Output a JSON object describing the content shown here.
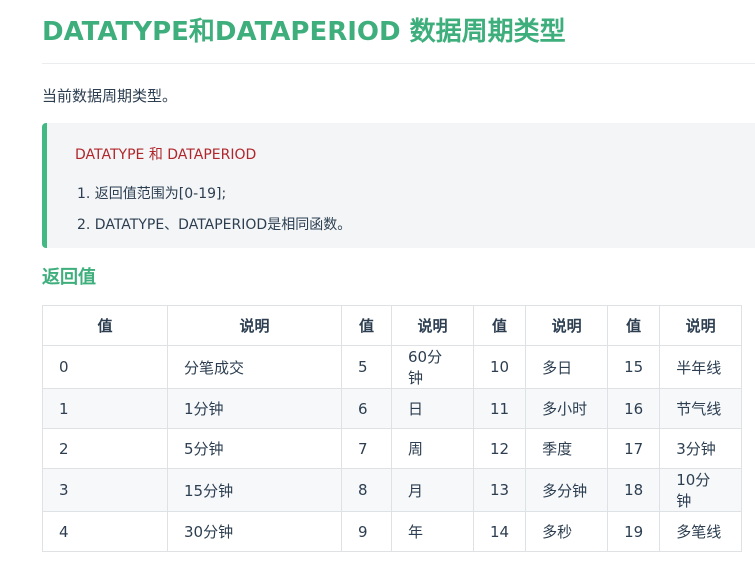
{
  "page": {
    "title": "DATATYPE和DATAPERIOD 数据周期类型",
    "intro": "当前数据周期类型。"
  },
  "tip": {
    "title": "DATATYPE 和 DATAPERIOD",
    "items": [
      "1. 返回值范围为[0-19];",
      "2. DATATYPE、DATAPERIOD是相同函数。"
    ]
  },
  "section": {
    "title": "返回值"
  },
  "table": {
    "headers": [
      "值",
      "说明",
      "值",
      "说明",
      "值",
      "说明",
      "值",
      "说明"
    ],
    "rows": [
      [
        "0",
        "分笔成交",
        "5",
        "60分钟",
        "10",
        "多日",
        "15",
        "半年线"
      ],
      [
        "1",
        "1分钟",
        "6",
        "日",
        "11",
        "多小时",
        "16",
        "节气线"
      ],
      [
        "2",
        "5分钟",
        "7",
        "周",
        "12",
        "季度",
        "17",
        "3分钟"
      ],
      [
        "3",
        "15分钟",
        "8",
        "月",
        "13",
        "多分钟",
        "18",
        "10分钟"
      ],
      [
        "4",
        "30分钟",
        "9",
        "年",
        "14",
        "多秒",
        "19",
        "多笔线"
      ]
    ]
  },
  "colors": {
    "heading": "#3eaf7c",
    "tip_border": "#42b983",
    "tip_title": "#b0262b",
    "tip_bg": "#f3f5f7",
    "row_alt_bg": "#f6f8fa",
    "table_border": "#dfe2e5"
  }
}
